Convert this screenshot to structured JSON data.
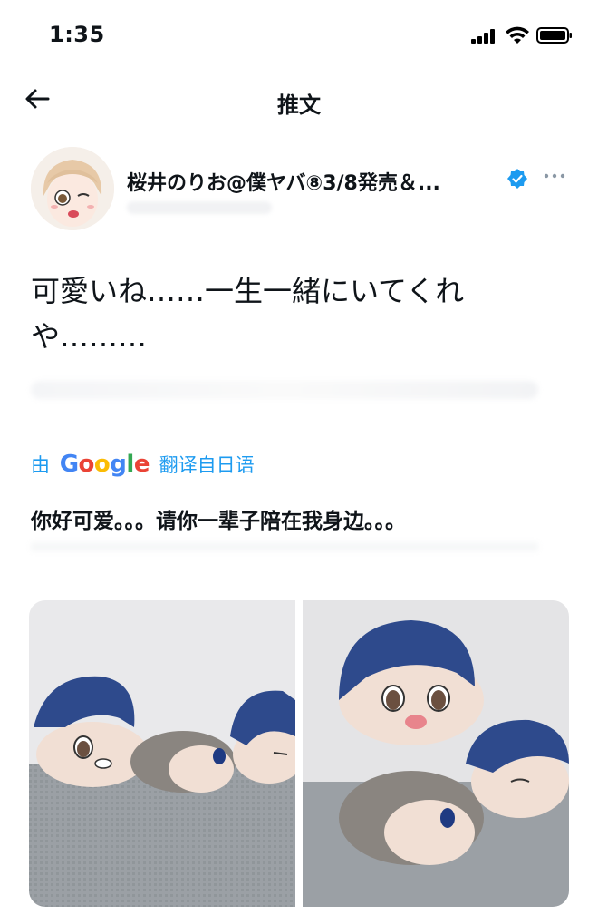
{
  "status_bar": {
    "time": "1:35"
  },
  "header": {
    "title": "推文"
  },
  "author": {
    "display_name": "桜井のりお@僕ヤバ⑧3/8発売＆..."
  },
  "tweet": {
    "text": "可愛いね……一生一緒にいてくれや………"
  },
  "translation": {
    "prefix": "由",
    "google_letters": [
      "G",
      "o",
      "o",
      "g",
      "l",
      "e"
    ],
    "suffix": "翻译自日语",
    "text": "你好可爱。。。请你一辈子陪在我身边。。。"
  },
  "colors": {
    "accent": "#1d9bf0",
    "text": "#0f1419",
    "plush_hair": "#2e4a8c",
    "plush_gray": "#8a8580",
    "plush_skin": "#f0dfd2",
    "fabric": "#9aa0a6"
  }
}
